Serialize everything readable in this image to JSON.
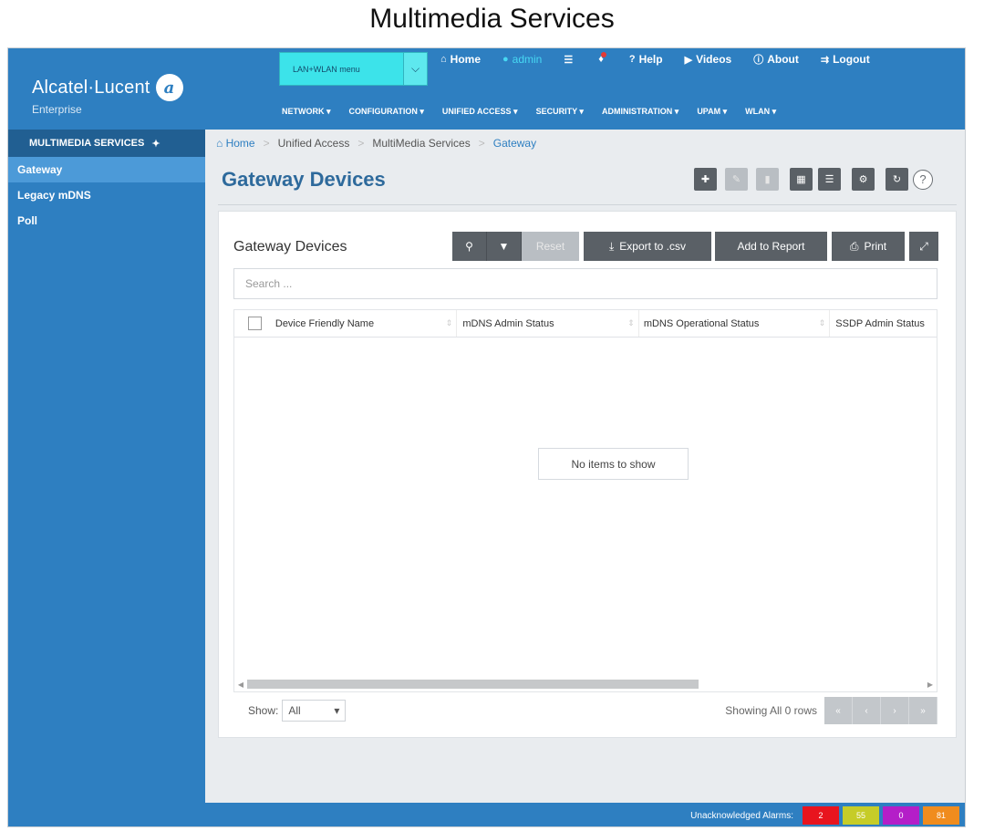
{
  "caption": "Multimedia Services",
  "header": {
    "logo_name": "Alcatel·Lucent",
    "logo_sub": "Enterprise",
    "site_select_value": "LAN+WLAN menu",
    "links": {
      "home": "Home",
      "admin": "admin",
      "help": "Help",
      "videos": "Videos",
      "about": "About",
      "logout": "Logout"
    },
    "nav": [
      "NETWORK ▾",
      "CONFIGURATION ▾",
      "UNIFIED ACCESS ▾",
      "SECURITY ▾",
      "ADMINISTRATION ▾",
      "UPAM ▾",
      "WLAN ▾"
    ]
  },
  "sidebar": {
    "title": "MULTIMEDIA SERVICES",
    "items": [
      {
        "label": "Gateway",
        "active": true
      },
      {
        "label": "Legacy mDNS",
        "active": false
      },
      {
        "label": "Poll",
        "active": false
      }
    ]
  },
  "breadcrumb": {
    "home": "Home",
    "level1": "Unified Access",
    "level2": "MultiMedia Services",
    "current": "Gateway",
    "separator": ">"
  },
  "page": {
    "title": "Gateway Devices"
  },
  "panel": {
    "title": "Gateway Devices",
    "reset_label": "Reset",
    "export_label": "Export to .csv",
    "report_label": "Add to Report",
    "print_label": "Print",
    "search_placeholder": "Search ...",
    "columns": [
      "Device Friendly Name",
      "mDNS Admin Status",
      "mDNS Operational Status",
      "SSDP Admin Status"
    ],
    "rows": [],
    "empty_message": "No items to show",
    "show_label": "Show:",
    "show_value": "All",
    "showing_text": "Showing All 0 rows"
  },
  "statusbar": {
    "label": "Unacknowledged Alarms:",
    "alarms": [
      {
        "value": "2",
        "color": "#e8141e"
      },
      {
        "value": "55",
        "color": "#c6cc28"
      },
      {
        "value": "0",
        "color": "#b41ec8"
      },
      {
        "value": "81",
        "color": "#f08c1e"
      }
    ]
  },
  "colors": {
    "brand_blue": "#2e7fc1",
    "site_select": "#3ce3ea",
    "admin_link": "#47d8f3"
  }
}
